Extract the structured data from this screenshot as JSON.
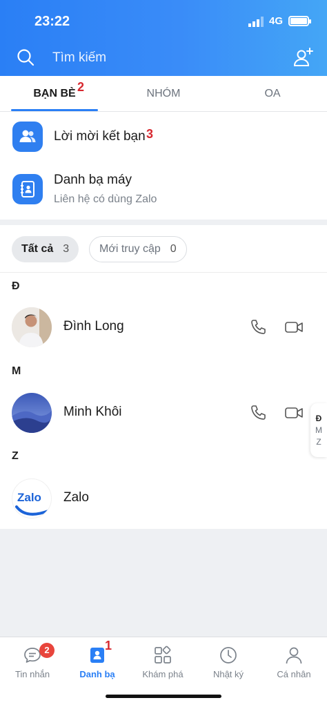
{
  "status_bar": {
    "time": "23:22",
    "network": "4G"
  },
  "header": {
    "search_placeholder": "Tìm kiếm",
    "search_icon": "search-icon",
    "add_friend_icon": "add-friend-icon"
  },
  "tabs": [
    {
      "label": "BẠN BÈ",
      "active": true,
      "annotation": "2"
    },
    {
      "label": "NHÓM",
      "active": false
    },
    {
      "label": "OA",
      "active": false
    }
  ],
  "friend_requests": {
    "label": "Lời mời kết bạn",
    "annotation": "3"
  },
  "phonebook": {
    "label": "Danh bạ máy",
    "subtitle": "Liên hệ có dùng Zalo"
  },
  "filters": [
    {
      "label": "Tất cả",
      "count": "3",
      "selected": true
    },
    {
      "label": "Mới truy cập",
      "count": "0",
      "selected": false
    }
  ],
  "contact_groups": [
    {
      "letter": "Đ",
      "contacts": [
        {
          "name": "Đình Long",
          "call": true,
          "video": true
        }
      ]
    },
    {
      "letter": "M",
      "contacts": [
        {
          "name": "Minh Khôi",
          "call": true,
          "video": true
        }
      ]
    },
    {
      "letter": "Z",
      "contacts": [
        {
          "name": "Zalo",
          "call": false,
          "video": false,
          "avatar_text": "Zalo"
        }
      ]
    }
  ],
  "index_bar": [
    "Đ",
    "M",
    "Z"
  ],
  "bottom_nav": [
    {
      "label": "Tin nhắn",
      "icon": "chat-icon",
      "badge": "2",
      "active": false
    },
    {
      "label": "Danh bạ",
      "icon": "contacts-icon",
      "active": true,
      "annotation": "1"
    },
    {
      "label": "Khám phá",
      "icon": "discover-icon",
      "active": false
    },
    {
      "label": "Nhật ký",
      "icon": "clock-icon",
      "active": false
    },
    {
      "label": "Cá nhân",
      "icon": "person-icon",
      "active": false
    }
  ],
  "colors": {
    "primary": "#2a7ff5",
    "badge": "#e8453c",
    "annotation": "#d7282f"
  }
}
